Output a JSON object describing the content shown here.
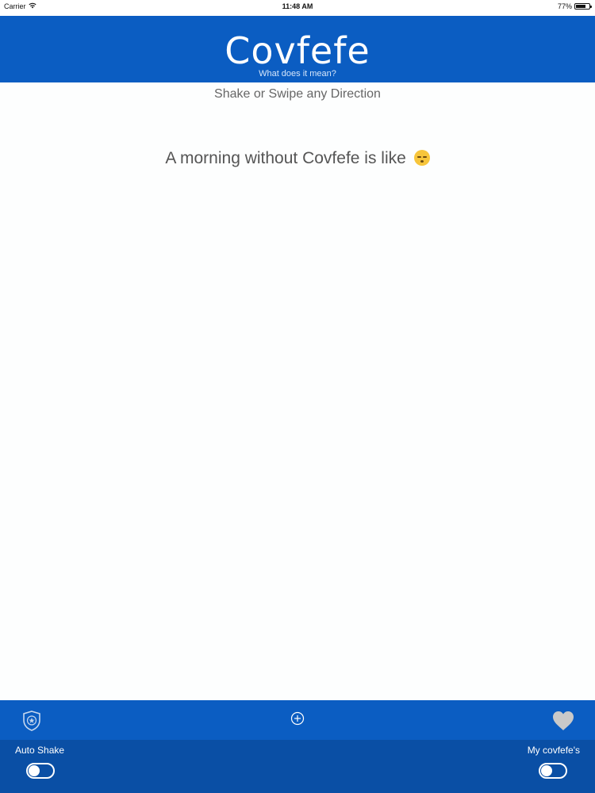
{
  "status_bar": {
    "carrier": "Carrier",
    "time": "11:48 AM",
    "battery_text": "77%",
    "battery_level": 0.77
  },
  "header": {
    "title": "Covfefe",
    "subtitle": "What does it mean?"
  },
  "main": {
    "instruction": "Shake or Swipe any Direction",
    "quote": "A morning without Covfefe is like",
    "quote_emoji": "sleeping-face-icon"
  },
  "toolbar": {
    "left_icon": "police-badge-icon",
    "center_icon": "add-circle-icon",
    "right_icon": "heart-icon"
  },
  "bottom_panel": {
    "auto_shake_label": "Auto Shake",
    "auto_shake_on": false,
    "my_covfefes_label": "My covfefe's",
    "my_covfefes_on": false
  },
  "colors": {
    "brand_blue": "#0b5dc2",
    "panel_blue": "#0a4fa5",
    "heart_gray": "#c9c9c9"
  }
}
